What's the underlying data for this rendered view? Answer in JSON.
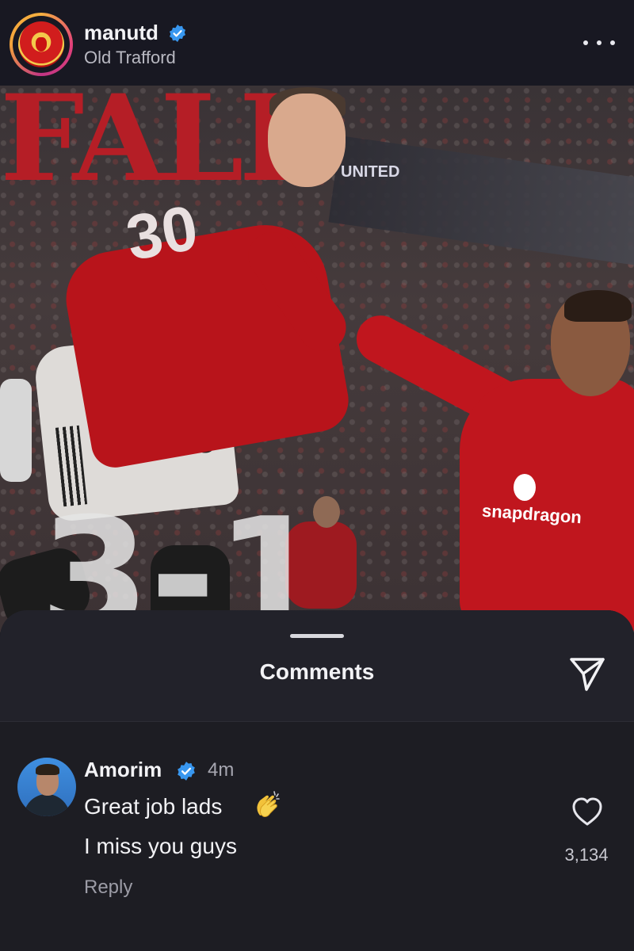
{
  "post": {
    "account": "manutd",
    "location": "Old Trafford",
    "photo": {
      "headline": "FALL",
      "score": "3-1",
      "shirt_number": "30",
      "shorts_number": "3",
      "sponsor": "snapdragon",
      "banner_text": "UNITED"
    }
  },
  "comments": {
    "title": "Comments",
    "items": [
      {
        "author": "Amorim",
        "time": "4m",
        "line1": "Great job lads",
        "line2": "I miss you guys",
        "likes": "3,134",
        "reply_label": "Reply"
      }
    ]
  },
  "icons": {
    "verified": "verified-badge-icon",
    "more": "more-dots-icon",
    "share": "paper-plane-icon",
    "like": "heart-icon",
    "clap": "clapping-hands-emoji"
  },
  "colors": {
    "verified": "#3897f0",
    "accent_red": "#b51e26"
  }
}
